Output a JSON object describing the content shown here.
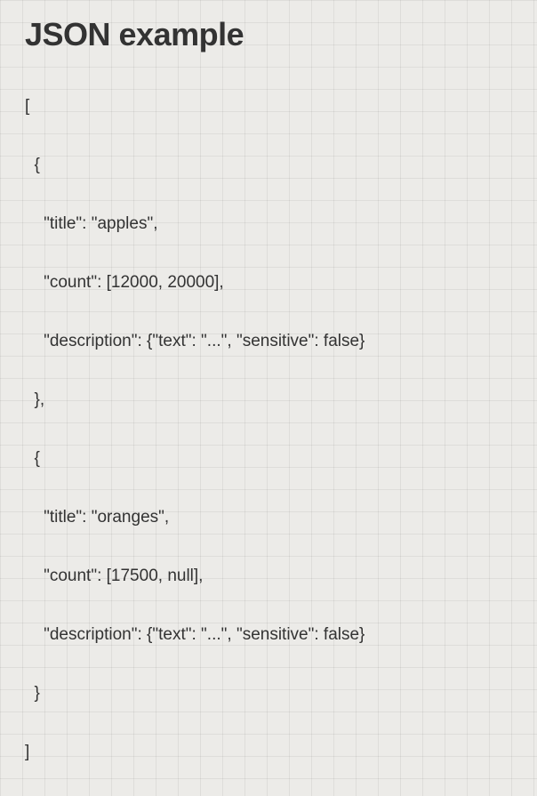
{
  "heading": "JSON example",
  "code": {
    "line1": "[",
    "line2": "  {",
    "line3": "    \"title\": \"apples\",",
    "line4": "    \"count\": [12000, 20000],",
    "line5": "    \"description\": {\"text\": \"...\", \"sensitive\": false}",
    "line6": "  },",
    "line7": "  {",
    "line8": "    \"title\": \"oranges\",",
    "line9": "    \"count\": [17500, null],",
    "line10": "    \"description\": {\"text\": \"...\", \"sensitive\": false}",
    "line11": "  }",
    "line12": "]"
  }
}
